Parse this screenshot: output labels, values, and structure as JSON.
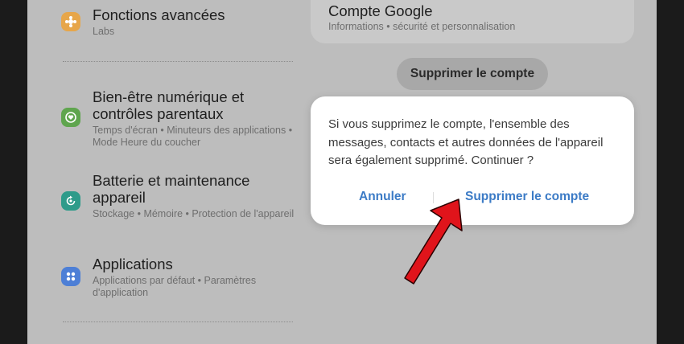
{
  "settings": {
    "items": [
      {
        "title": "Fonctions avancées",
        "subtitle": "Labs",
        "icon": "star-gear-icon",
        "color": "#e7a64a"
      },
      {
        "title": "Bien-être numérique et contrôles parentaux",
        "subtitle": "Temps d'écran  •  Minuteurs des applications  •  Mode Heure du coucher",
        "icon": "heart-circle-icon",
        "color": "#5fa54e"
      },
      {
        "title": "Batterie et maintenance appareil",
        "subtitle": "Stockage  •  Mémoire  •  Protection de l'appareil",
        "icon": "refresh-circle-icon",
        "color": "#2e9b8a"
      },
      {
        "title": "Applications",
        "subtitle": "Applications par défaut  •  Paramètres d'application",
        "icon": "apps-grid-icon",
        "color": "#4d7fd6"
      }
    ]
  },
  "account": {
    "title": "Compte Google",
    "subtitle": "Informations  •  sécurité et personnalisation",
    "remove_button": "Supprimer le compte"
  },
  "dialog": {
    "message": "Si vous supprimez le compte, l'ensemble des messages, contacts et autres données de l'appareil sera également supprimé. Continuer ?",
    "cancel": "Annuler",
    "confirm": "Supprimer le compte",
    "accent": "#3c7bc6"
  },
  "annotation": {
    "arrow_icon": "red-arrow-icon",
    "arrow_color": "#e0141b"
  }
}
